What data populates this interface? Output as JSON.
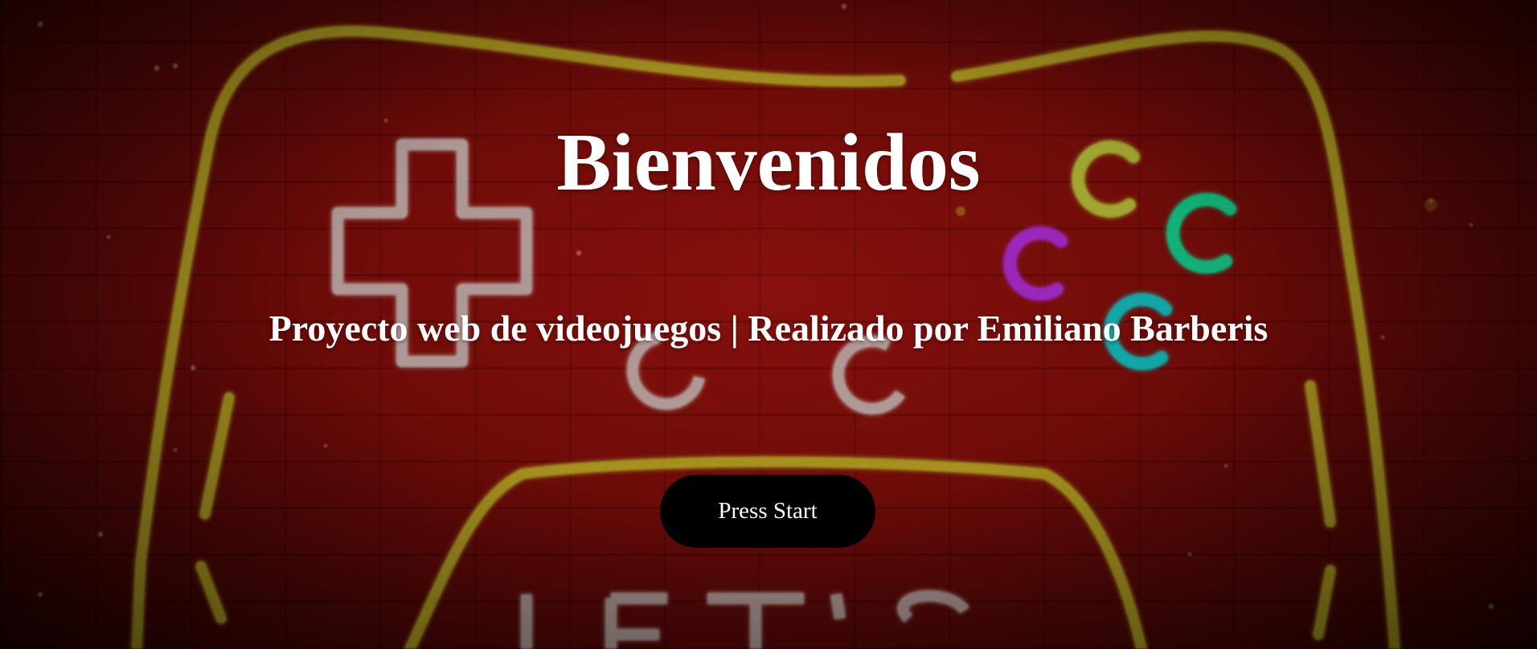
{
  "hero": {
    "title": "Bienvenidos",
    "subtitle": "Proyecto web de videojuegos | Realizado por Emiliano Barberis",
    "start_button_label": "Press Start",
    "background_image_text": "LET'S"
  },
  "colors": {
    "background_red": "#9b1410",
    "neon_yellow": "#c8c02a",
    "neon_white": "#d9d6d2",
    "neon_green": "#19c98a",
    "neon_purple": "#b02fd6",
    "neon_teal": "#18bfc0",
    "button_bg": "#000000",
    "text": "#ffffff"
  }
}
